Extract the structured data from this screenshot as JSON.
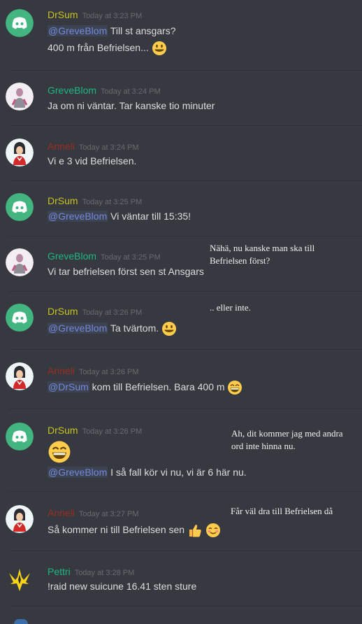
{
  "users": {
    "drsum": {
      "name": "DrSum",
      "color": "#c9c21f"
    },
    "greve": {
      "name": "GreveBlom",
      "color": "#1fb585"
    },
    "anneli": {
      "name": "Anneli",
      "color": "#992d22"
    },
    "pettri": {
      "name": "Pettri",
      "color": "#1fb585"
    }
  },
  "messages": [
    {
      "author": "DrSum",
      "timestamp": "Today at 3:23 PM",
      "mention": "@GreveBlom",
      "text1": "Till st ansgars?",
      "text2": "400 m från Befrielsen..."
    },
    {
      "author": "GreveBlom",
      "timestamp": "Today at 3:24 PM",
      "text1": "Ja om ni väntar. Tar kanske tio minuter"
    },
    {
      "author": "Anneli",
      "timestamp": "Today at 3:24 PM",
      "text1": "Vi e 3 vid Befrielsen."
    },
    {
      "author": "DrSum",
      "timestamp": "Today at 3:25 PM",
      "mention": "@GreveBlom",
      "text1": "Vi väntar till 15:35!"
    },
    {
      "author": "GreveBlom",
      "timestamp": "Today at 3:25 PM",
      "text1": "Vi tar befrielsen först sen st Ansgars"
    },
    {
      "author": "DrSum",
      "timestamp": "Today at 3:26 PM",
      "mention": "@GreveBlom",
      "text1": "Ta tvärtom."
    },
    {
      "author": "Anneli",
      "timestamp": "Today at 3:26 PM",
      "mention": "@DrSum",
      "text1": "kom till Befrielsen. Bara 400 m"
    },
    {
      "author": "DrSum",
      "timestamp": "Today at 3:26 PM",
      "mention": "@GreveBlom",
      "text1": "I så fall kör vi nu, vi är 6 här nu."
    },
    {
      "author": "Anneli",
      "timestamp": "Today at 3:27 PM",
      "text1": "Så kommer ni till Befrielsen sen"
    },
    {
      "author": "Pettri",
      "timestamp": "Today at 3:28 PM",
      "text1": "!raid new suicune 16.41 sten sture"
    }
  ],
  "notes": {
    "n1_line1": "Nähä, nu kanske man ska till",
    "n1_line2": "Befrielsen först?",
    "n2": ".. eller inte.",
    "n3_line1": "Ah, dit kommer jag med andra",
    "n3_line2": "ord inte hinna nu.",
    "n4": "Får väl dra till Befrielsen då"
  },
  "icons": {
    "discord": "discord-logo-icon",
    "pokemon": "pokemon-trainer-icon",
    "anneli": "trainer-avatar-icon",
    "instinct": "team-instinct-icon"
  }
}
